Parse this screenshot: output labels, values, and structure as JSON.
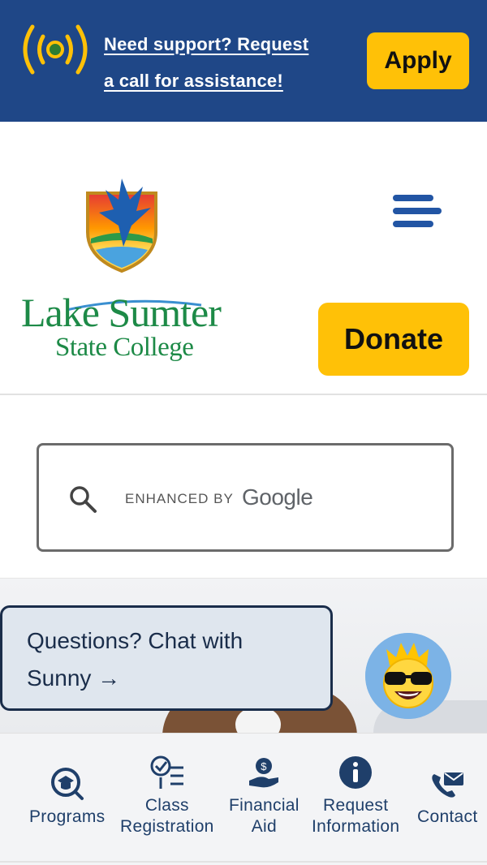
{
  "topbar": {
    "support_line1": "Need support? Request",
    "support_line2": "a call for assistance!",
    "apply_label": "Apply",
    "background": "#1f4787",
    "accent": "#ffc107"
  },
  "header": {
    "logo_line1": "Lake Sumter",
    "logo_line2": "State College",
    "donate_label": "Donate",
    "brand_green": "#1d8a47",
    "menu_icon": "hamburger-menu-icon"
  },
  "search": {
    "enhanced_by": "ENHANCED BY",
    "provider": "Google",
    "icon": "search-icon"
  },
  "chat": {
    "prompt_line1": "Questions? Chat with",
    "prompt_line2": "Sunny →",
    "avatar_icon": "sunny-avatar-icon"
  },
  "bottom_nav": [
    {
      "line1": "Programs",
      "line2": "",
      "icon": "graduation-search-icon"
    },
    {
      "line1": "Class",
      "line2": "Registration",
      "icon": "checklist-icon"
    },
    {
      "line1": "Financial",
      "line2": "Aid",
      "icon": "money-hand-icon"
    },
    {
      "line1": "Request",
      "line2": "Information",
      "icon": "info-icon"
    },
    {
      "line1": "Contact",
      "line2": "",
      "icon": "phone-mail-icon"
    }
  ]
}
